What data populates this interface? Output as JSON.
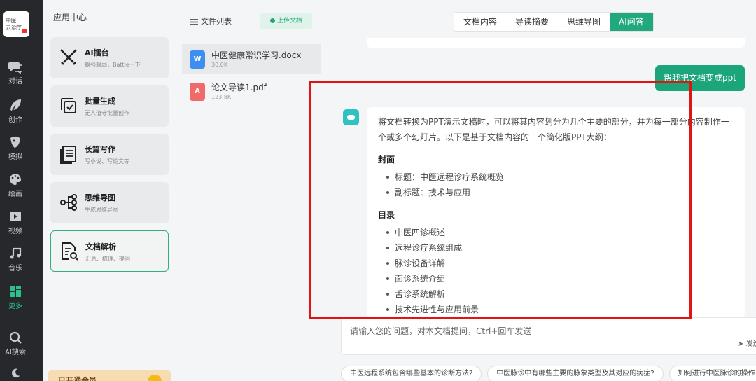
{
  "nav": {
    "logo_line1": "中医",
    "logo_line2": "云诊疗",
    "items": [
      {
        "label": "对话",
        "icon": "chat-icon"
      },
      {
        "label": "创作",
        "icon": "feather-icon"
      },
      {
        "label": "模拟",
        "icon": "mask-icon"
      },
      {
        "label": "绘画",
        "icon": "palette-icon"
      },
      {
        "label": "视频",
        "icon": "video-icon"
      },
      {
        "label": "音乐",
        "icon": "music-icon"
      },
      {
        "label": "更多",
        "icon": "grid-icon"
      },
      {
        "label": "AI搜索",
        "icon": "search-icon"
      }
    ],
    "active_color": "#2cc08c"
  },
  "apps": {
    "title": "应用中心",
    "cards": [
      {
        "title": "AI擂台",
        "subtitle": "飙强飙弱，Battle一下",
        "icon": "crossed-swords-icon"
      },
      {
        "title": "批量生成",
        "subtitle": "无人值守批量创作",
        "icon": "batch-copy-icon"
      },
      {
        "title": "长篇写作",
        "subtitle": "写小说、写论文等",
        "icon": "long-doc-icon"
      },
      {
        "title": "思维导图",
        "subtitle": "生成思维导图",
        "icon": "mindmap-icon"
      },
      {
        "title": "文档解析",
        "subtitle": "汇总、梳理、提问",
        "icon": "doc-search-icon"
      }
    ],
    "member_label": "已开通会员"
  },
  "files": {
    "header": "文件列表",
    "upload_label": "上传文档",
    "list": [
      {
        "name": "中医健康常识学习.docx",
        "size": "30.0K",
        "icon": "word-file-icon",
        "color": "#3d8fef"
      },
      {
        "name": "论文导读1.pdf",
        "size": "123.8K",
        "icon": "pdf-file-icon",
        "color": "#f06a6a"
      }
    ]
  },
  "main": {
    "tabs": [
      "文档内容",
      "导读摘要",
      "思维导图",
      "AI问答"
    ],
    "active_tab": "AI问答",
    "user_prompt": "帮我把文档变成ppt",
    "answer": {
      "intro": "将文档转换为PPT演示文稿时，可以将其内容划分为几个主要的部分，并为每一部分内容制作一个或多个幻灯片。以下是基于文档内容的一个简化版PPT大纲：",
      "sections": [
        {
          "heading": "封面",
          "items": [
            "标题：中医远程诊疗系统概览",
            "副标题：技术与应用"
          ]
        },
        {
          "heading": "目录",
          "items": [
            "中医四诊概述",
            "远程诊疗系统组成",
            "脉诊设备详解",
            "面诊系统介绍",
            "舌诊系统解析",
            "技术先进性与应用前景"
          ]
        }
      ]
    },
    "input_placeholder": "请输入您的问题，对本文档提问，Ctrl+回车发送",
    "send_label": "发送",
    "suggestions": [
      "中医远程系统包含哪些基本的诊断方法?",
      "中医脉诊中有哪些主要的脉象类型及其对应的病症?",
      "如何进行中医脉诊的操作"
    ],
    "accent": "#1aa57b"
  }
}
